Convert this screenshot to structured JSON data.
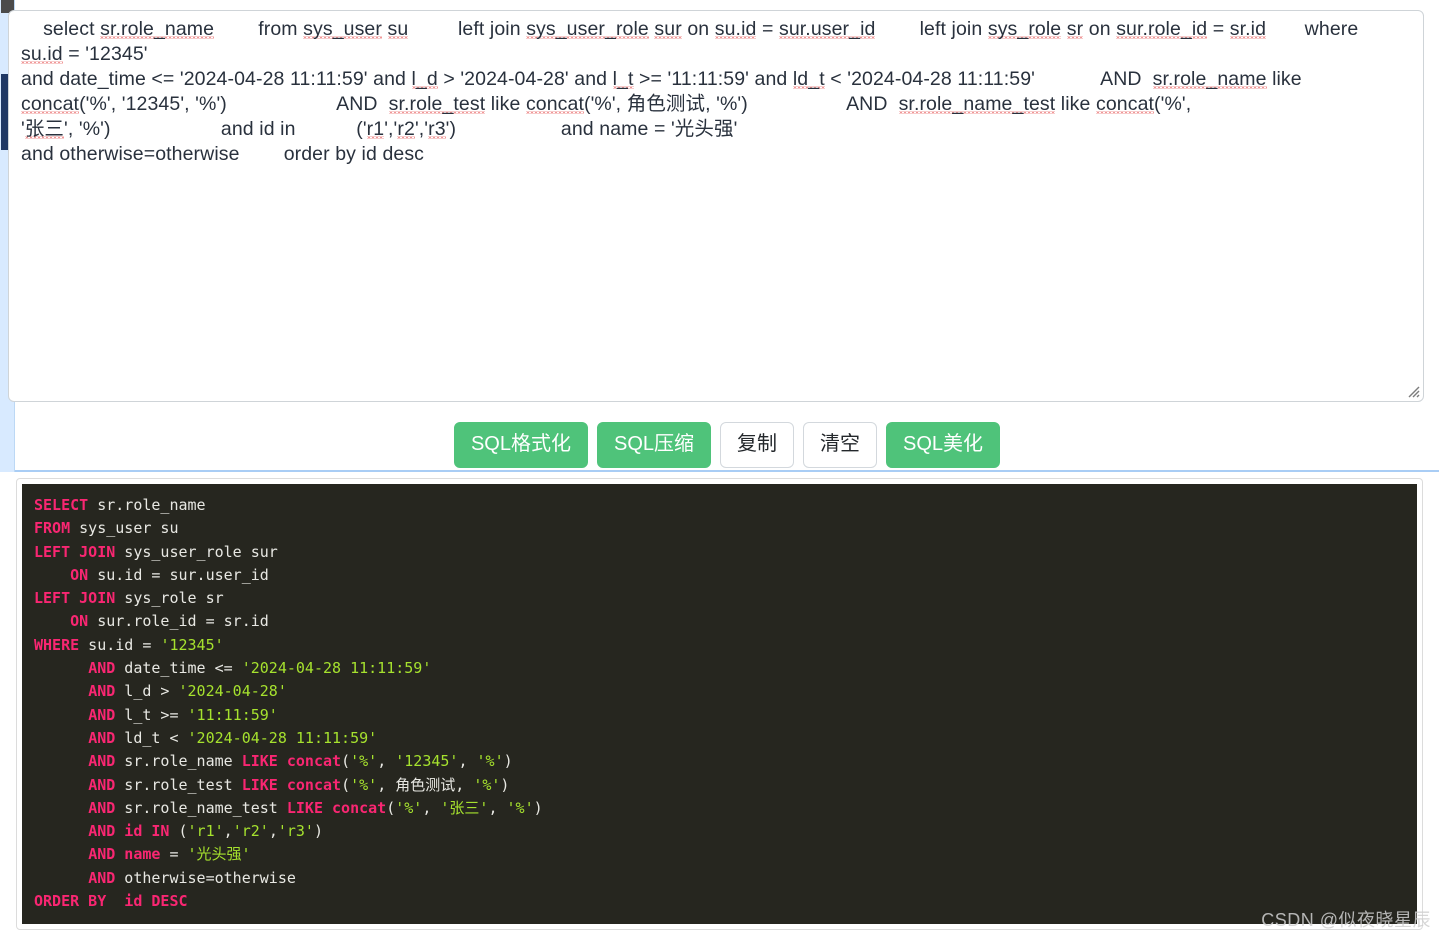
{
  "editor": {
    "name": "sql-input-textarea",
    "value": "    select sr.role_name        from sys_user su         left join sys_user_role sur on su.id = sur.user_id        left join sys_role sr on sur.role_id = sr.id        where  su.id = '12345'    and date_time <= '2024-04-28 11:11:59' and l_d > '2024-04-28' and l_t >= '11:11:59' and ld_t < '2024-04-28 11:11:59'            AND  sr.role_name like concat('%', '12345', '%')                    AND  sr.role_test like concat('%', 角色测试, '%')              AND  sr.role_name_test like concat('%', '张三', '%')                    and id in         ('r1','r2','r3')               and name = '光头强'   and otherwise=otherwise     order by id desc",
    "placeholder": "",
    "lines": [
      [
        {
          "t": "    select ",
          "sq": false
        },
        {
          "t": "sr.role_name",
          "sq": true
        },
        {
          "t": "        from ",
          "sq": false
        },
        {
          "t": "sys_user",
          "sq": true
        },
        {
          "t": " ",
          "sq": false
        },
        {
          "t": "su",
          "sq": true
        },
        {
          "t": "         left join ",
          "sq": false
        },
        {
          "t": "sys_user_role",
          "sq": true
        },
        {
          "t": " ",
          "sq": false
        },
        {
          "t": "sur",
          "sq": true
        },
        {
          "t": " on ",
          "sq": false
        },
        {
          "t": "su.id",
          "sq": true
        },
        {
          "t": " = ",
          "sq": false
        },
        {
          "t": "sur.user_id",
          "sq": true
        },
        {
          "t": "        left join ",
          "sq": false
        },
        {
          "t": "sys_role",
          "sq": true
        },
        {
          "t": " ",
          "sq": false
        },
        {
          "t": "sr",
          "sq": true
        },
        {
          "t": " on ",
          "sq": false
        },
        {
          "t": "sur.role_id",
          "sq": true
        },
        {
          "t": " = ",
          "sq": false
        },
        {
          "t": "sr.id",
          "sq": true
        },
        {
          "t": "       where   ",
          "sq": false
        },
        {
          "t": "su.id",
          "sq": true
        },
        {
          "t": " = '12345'",
          "sq": false
        }
      ],
      [
        {
          "t": "and date_time <= '2024-04-28 11:11:59' and ",
          "sq": false
        },
        {
          "t": "l_d",
          "sq": true
        },
        {
          "t": " > '2024-04-28' and ",
          "sq": false
        },
        {
          "t": "l_t",
          "sq": true
        },
        {
          "t": " >= '11:11:59' and ",
          "sq": false
        },
        {
          "t": "ld_t",
          "sq": true
        },
        {
          "t": " < '2024-04-28 11:11:59'            AND  ",
          "sq": false
        },
        {
          "t": "sr.role_name",
          "sq": true
        },
        {
          "t": " like",
          "sq": false
        }
      ],
      [
        {
          "t": "concat",
          "sq": true
        },
        {
          "t": "('%', '12345', '%')                    AND  ",
          "sq": false
        },
        {
          "t": "sr.role_test",
          "sq": true
        },
        {
          "t": " like ",
          "sq": false
        },
        {
          "t": "concat",
          "sq": true
        },
        {
          "t": "('%', 角色测试, '%')                  AND  ",
          "sq": false
        },
        {
          "t": "sr.role_name_test",
          "sq": true
        },
        {
          "t": " like ",
          "sq": false
        },
        {
          "t": "concat",
          "sq": true
        },
        {
          "t": "('%',",
          "sq": false
        }
      ],
      [
        {
          "t": "'",
          "sq": false
        },
        {
          "t": "张三",
          "sq": true
        },
        {
          "t": "', '%')                    and id in           ('",
          "sq": false
        },
        {
          "t": "r1",
          "sq": true
        },
        {
          "t": "','",
          "sq": false
        },
        {
          "t": "r2",
          "sq": true
        },
        {
          "t": "','",
          "sq": false
        },
        {
          "t": "r3",
          "sq": true
        },
        {
          "t": "')                   and name = '光头强'",
          "sq": false
        }
      ],
      [
        {
          "t": "and otherwise=otherwise        order by id desc",
          "sq": false
        }
      ]
    ]
  },
  "toolbar": {
    "buttons": [
      {
        "label": "SQL格式化",
        "name": "sql-format-button",
        "style": "primary"
      },
      {
        "label": "SQL压缩",
        "name": "sql-compress-button",
        "style": "primary"
      },
      {
        "label": "复制",
        "name": "copy-button",
        "style": "default"
      },
      {
        "label": "清空",
        "name": "clear-button",
        "style": "default"
      },
      {
        "label": "SQL美化",
        "name": "sql-beautify-button",
        "style": "primary"
      }
    ],
    "primary_color": "#4fc37a",
    "default_bg": "#ffffff",
    "default_border": "#d3d8dd"
  },
  "output": {
    "name": "formatted-sql-output",
    "background": "#26261f",
    "keyword_color": "#f92672",
    "string_color": "#a6e22e",
    "text_color": "#e8e8e3",
    "code_lines": [
      [
        {
          "c": "kw",
          "t": "SELECT"
        },
        {
          "c": "pl",
          "t": " sr.role_name"
        }
      ],
      [
        {
          "c": "kw",
          "t": "FROM"
        },
        {
          "c": "pl",
          "t": " sys_user su"
        }
      ],
      [
        {
          "c": "kw",
          "t": "LEFT JOIN"
        },
        {
          "c": "pl",
          "t": " sys_user_role sur"
        }
      ],
      [
        {
          "c": "pl",
          "t": "    "
        },
        {
          "c": "kw",
          "t": "ON"
        },
        {
          "c": "pl",
          "t": " su.id = sur.user_id"
        }
      ],
      [
        {
          "c": "kw",
          "t": "LEFT JOIN"
        },
        {
          "c": "pl",
          "t": " sys_role sr"
        }
      ],
      [
        {
          "c": "pl",
          "t": "    "
        },
        {
          "c": "kw",
          "t": "ON"
        },
        {
          "c": "pl",
          "t": " sur.role_id = sr.id"
        }
      ],
      [
        {
          "c": "kw",
          "t": "WHERE"
        },
        {
          "c": "pl",
          "t": " su.id = "
        },
        {
          "c": "str",
          "t": "'12345'"
        }
      ],
      [
        {
          "c": "pl",
          "t": "      "
        },
        {
          "c": "kw",
          "t": "AND"
        },
        {
          "c": "pl",
          "t": " date_time <= "
        },
        {
          "c": "str",
          "t": "'2024-04-28 11:11:59'"
        }
      ],
      [
        {
          "c": "pl",
          "t": "      "
        },
        {
          "c": "kw",
          "t": "AND"
        },
        {
          "c": "pl",
          "t": " l_d > "
        },
        {
          "c": "str",
          "t": "'2024-04-28'"
        }
      ],
      [
        {
          "c": "pl",
          "t": "      "
        },
        {
          "c": "kw",
          "t": "AND"
        },
        {
          "c": "pl",
          "t": " l_t >= "
        },
        {
          "c": "str",
          "t": "'11:11:59'"
        }
      ],
      [
        {
          "c": "pl",
          "t": "      "
        },
        {
          "c": "kw",
          "t": "AND"
        },
        {
          "c": "pl",
          "t": " ld_t < "
        },
        {
          "c": "str",
          "t": "'2024-04-28 11:11:59'"
        }
      ],
      [
        {
          "c": "pl",
          "t": "      "
        },
        {
          "c": "kw",
          "t": "AND"
        },
        {
          "c": "pl",
          "t": " sr.role_name "
        },
        {
          "c": "kw",
          "t": "LIKE concat"
        },
        {
          "c": "pl",
          "t": "("
        },
        {
          "c": "str",
          "t": "'%'"
        },
        {
          "c": "pl",
          "t": ", "
        },
        {
          "c": "str",
          "t": "'12345'"
        },
        {
          "c": "pl",
          "t": ", "
        },
        {
          "c": "str",
          "t": "'%'"
        },
        {
          "c": "pl",
          "t": ")"
        }
      ],
      [
        {
          "c": "pl",
          "t": "      "
        },
        {
          "c": "kw",
          "t": "AND"
        },
        {
          "c": "pl",
          "t": " sr.role_test "
        },
        {
          "c": "kw",
          "t": "LIKE concat"
        },
        {
          "c": "pl",
          "t": "("
        },
        {
          "c": "str",
          "t": "'%'"
        },
        {
          "c": "pl",
          "t": ", 角色测试, "
        },
        {
          "c": "str",
          "t": "'%'"
        },
        {
          "c": "pl",
          "t": ")"
        }
      ],
      [
        {
          "c": "pl",
          "t": "      "
        },
        {
          "c": "kw",
          "t": "AND"
        },
        {
          "c": "pl",
          "t": " sr.role_name_test "
        },
        {
          "c": "kw",
          "t": "LIKE concat"
        },
        {
          "c": "pl",
          "t": "("
        },
        {
          "c": "str",
          "t": "'%'"
        },
        {
          "c": "pl",
          "t": ", "
        },
        {
          "c": "str",
          "t": "'张三'"
        },
        {
          "c": "pl",
          "t": ", "
        },
        {
          "c": "str",
          "t": "'%'"
        },
        {
          "c": "pl",
          "t": ")"
        }
      ],
      [
        {
          "c": "pl",
          "t": "      "
        },
        {
          "c": "kw",
          "t": "AND id IN"
        },
        {
          "c": "pl",
          "t": " ("
        },
        {
          "c": "str",
          "t": "'r1'"
        },
        {
          "c": "pl",
          "t": ","
        },
        {
          "c": "str",
          "t": "'r2'"
        },
        {
          "c": "pl",
          "t": ","
        },
        {
          "c": "str",
          "t": "'r3'"
        },
        {
          "c": "pl",
          "t": ")"
        }
      ],
      [
        {
          "c": "pl",
          "t": "      "
        },
        {
          "c": "kw",
          "t": "AND name"
        },
        {
          "c": "pl",
          "t": " = "
        },
        {
          "c": "str",
          "t": "'光头强'"
        }
      ],
      [
        {
          "c": "pl",
          "t": "      "
        },
        {
          "c": "kw",
          "t": "AND"
        },
        {
          "c": "pl",
          "t": " otherwise=otherwise"
        }
      ],
      [
        {
          "c": "kw",
          "t": "ORDER BY  id DESC"
        }
      ]
    ]
  },
  "watermark": {
    "text": "CSDN @似夜晓星辰"
  }
}
